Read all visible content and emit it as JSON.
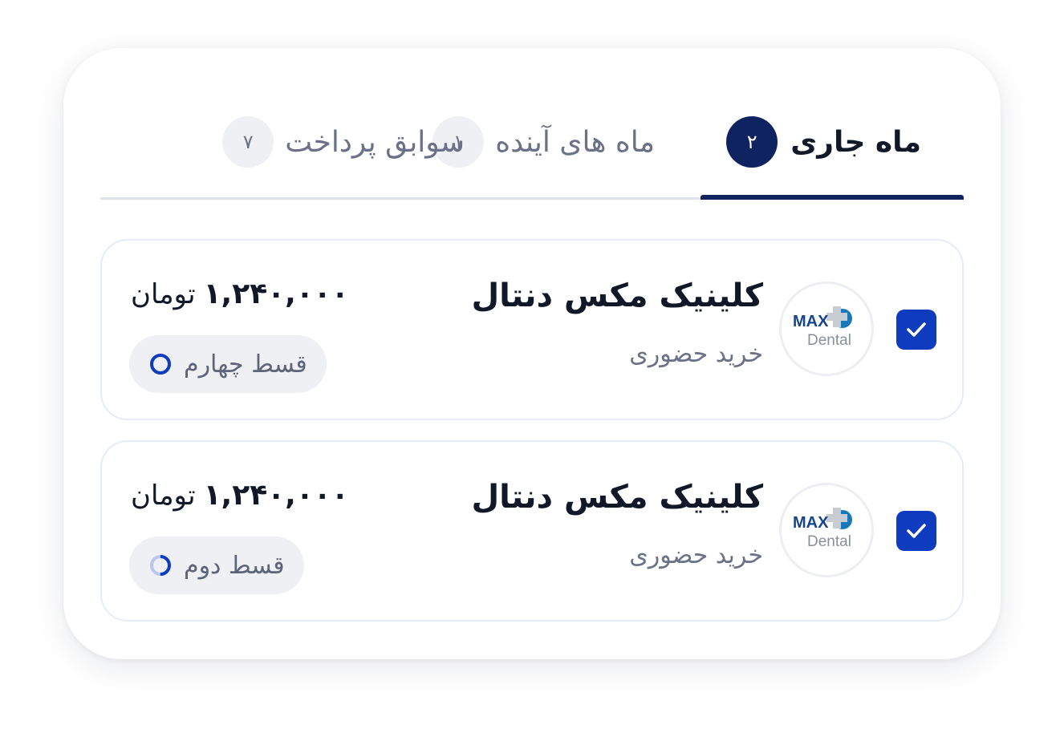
{
  "tabs": [
    {
      "label": "ماه جاری",
      "count": "۲",
      "active": true
    },
    {
      "label": "ماه های آینده",
      "count": "۱",
      "active": false
    },
    {
      "label": "سوابق پرداخت",
      "count": "۷",
      "active": false
    }
  ],
  "installments": [
    {
      "clinic": "کلینیک مکس دنتال",
      "type": "خرید حضوری",
      "amount": "۱,۲۴۰,۰۰۰",
      "currency": "تومان",
      "installment_label": "قسط چهارم",
      "logo_top": "MAX",
      "logo_bottom": "Dental",
      "checked": true
    },
    {
      "clinic": "کلینیک مکس دنتال",
      "type": "خرید حضوری",
      "amount": "۱,۲۴۰,۰۰۰",
      "currency": "تومان",
      "installment_label": "قسط دوم",
      "logo_top": "MAX",
      "logo_bottom": "Dental",
      "checked": true
    }
  ],
  "colors": {
    "primary": "#0f2360",
    "checkbox": "#0f3bbf",
    "logo_blue": "#1a78b8"
  }
}
